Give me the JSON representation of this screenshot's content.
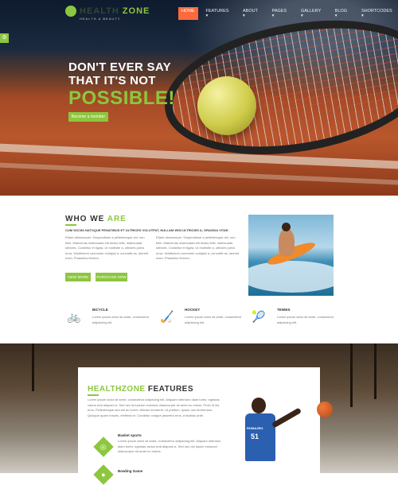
{
  "brand": {
    "name_a": "HEALTH",
    "name_b": "ZONE",
    "tagline": "HEALTH & BEAUTY"
  },
  "menu": [
    {
      "label": "HOME",
      "active": true
    },
    {
      "label": "FEATURES ▾"
    },
    {
      "label": "ABOUT ▾"
    },
    {
      "label": "PAGES ▾"
    },
    {
      "label": "GALLERY ▾"
    },
    {
      "label": "BLOG ▾"
    },
    {
      "label": "SHORTCODES ▾"
    }
  ],
  "side_tab": "⚙",
  "hero": {
    "line1": "DON'T EVER SAY",
    "line2": "THAT IT'S NOT",
    "big": "POSSIBLE!",
    "button": "Become a member"
  },
  "who": {
    "title_a": "WHO WE ",
    "title_b": "ARE",
    "subtitle": "CUM SOCIIS NATOQUE PENATIBUS ET ULTRICES VOLUTPAT, NULLAM WISI ULTRICIES A, GRAVIDA VITAE.",
    "col1": "Etiam ullamcorper. Suspendisse a pellentesque dui, non felis. Maecenas malesuada elit lectus felis, malesuada ultricies. Curabitur et ligula. Ut molestie a, ultricies porta urna. Vestibulum commodo volutpat a, convallis ac, laoreet enim. Phasellus fermen.",
    "col2": "Etiam ullamcorper. Suspendisse a pellentesque dui, non felis. Maecenas malesuada elit lectus felis, malesuada ultricies. Curabitur et ligula. Ut molestie a, ultricies porta urna. Vestibulum commodo volutpat a, convallis ac, laoreet enim. Phasellus fermen.",
    "btn_view": "VIEW MORE",
    "btn_purchase": "PURCHASE NOW"
  },
  "sports": [
    {
      "icon": "bicycle-icon",
      "glyph": "🚲",
      "name": "BICYCLE",
      "desc": "Lorem ipsum dolor sit amet, consectetur adipiscing elit."
    },
    {
      "icon": "hockey-icon",
      "glyph": "🏑",
      "name": "HOCKEY",
      "desc": "Lorem ipsum dolor sit amet, consectetur adipiscing elit."
    },
    {
      "icon": "tennis-icon",
      "glyph": "🎾",
      "name": "TENNIS",
      "desc": "Lorem ipsum dolor sit amet, consectetur adipiscing elit."
    }
  ],
  "features": {
    "title_a": "HEALTHZONE",
    "title_b": " FEATURES",
    "intro": "Lorem ipsum dolor sit amet, consectetur adipiscing elit. Aliquam interdum diam tortor, egestas varius erat aliquam a. Sed nec dui ipsum euismod ullamcorper sit amet eu metus. Proin id dui eros. Pellentesque sed elit ac lorem ultricies hendrerit. Ut pretium, ipsum nec fermentum. Quisque quam mauris, eleifend et. Curabitur congue pharetra eros, a facilisis ante.",
    "items": [
      {
        "title": "Basket sports",
        "desc": "Lorem ipsum dolor sit amet, consectetur adipiscing elit. Aliquam interdum diam tortor, egestas varius erat aliquam a. Sed nec dui ipsum euismod ullamcorper sit amet eu metus."
      },
      {
        "title": "Bowling Game",
        "desc": ""
      }
    ],
    "jersey_name": "ROMAJRO",
    "jersey_number": "51"
  },
  "colors": {
    "accent": "#8dc63f",
    "active_menu": "#ff6a3d"
  }
}
